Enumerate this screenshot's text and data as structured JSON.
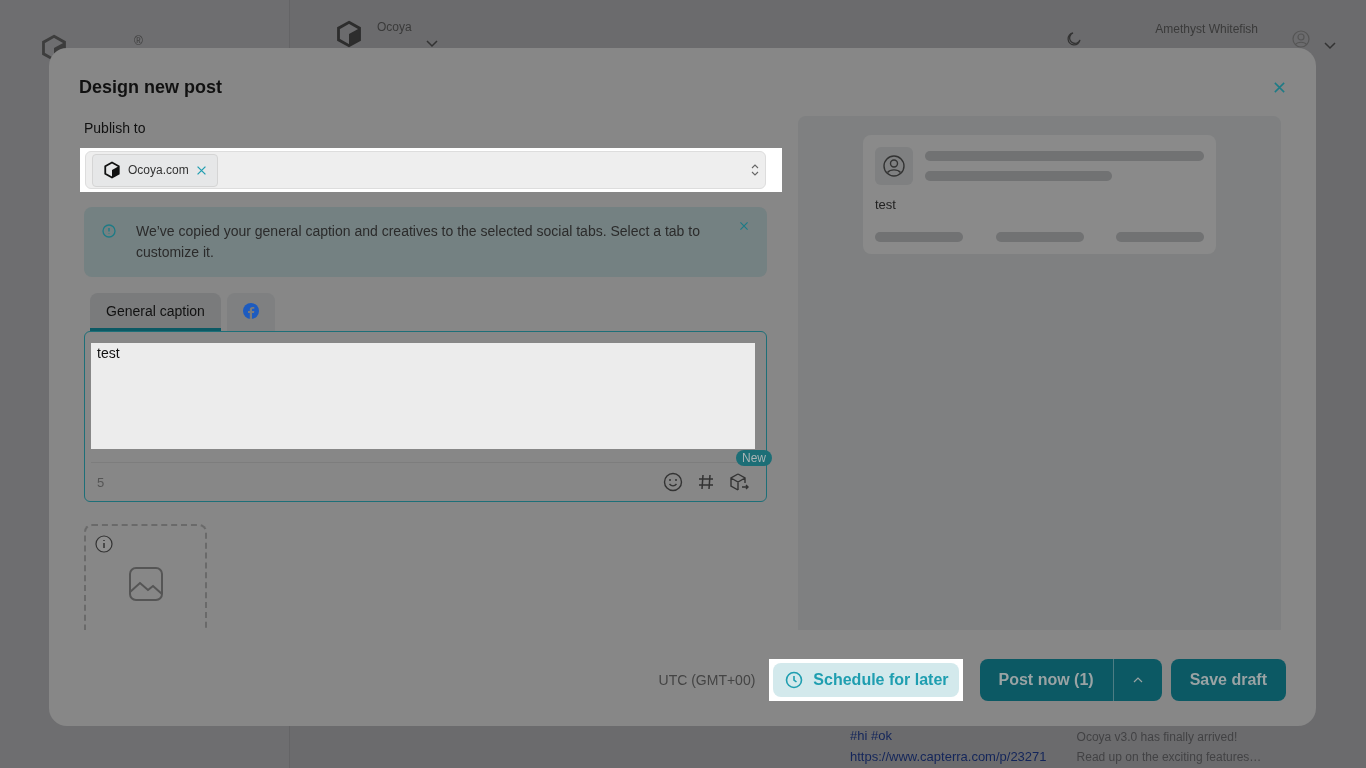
{
  "app": {
    "logo_mark": "®",
    "workspace": {
      "name": "Ocoya"
    },
    "user": {
      "name": "Amethyst Whitefish"
    },
    "feed": {
      "tags": "#hi #ok",
      "link": "https://www.capterra.com/p/23271"
    },
    "news": {
      "title": "Ocoya v3.0 has finally arrived!",
      "body": "Read up on the exciting features…"
    }
  },
  "modal": {
    "title": "Design new post",
    "publish_to": {
      "label": "Publish to",
      "chips": [
        {
          "label": "Ocoya.com"
        }
      ]
    },
    "notice": "We’ve copied your general caption and creatives to the selected social tabs. Select a tab to customize it.",
    "tabs": [
      {
        "kind": "text",
        "label": "General caption",
        "selected": true
      },
      {
        "kind": "facebook",
        "selected": false
      }
    ],
    "caption": {
      "value": "test",
      "count": "5",
      "badge": "New"
    },
    "preview": {
      "text": "test"
    },
    "footer": {
      "timezone": "UTC (GMT+00)",
      "schedule": "Schedule for later",
      "post_now": "Post now (1)",
      "save_draft": "Save draft"
    }
  }
}
